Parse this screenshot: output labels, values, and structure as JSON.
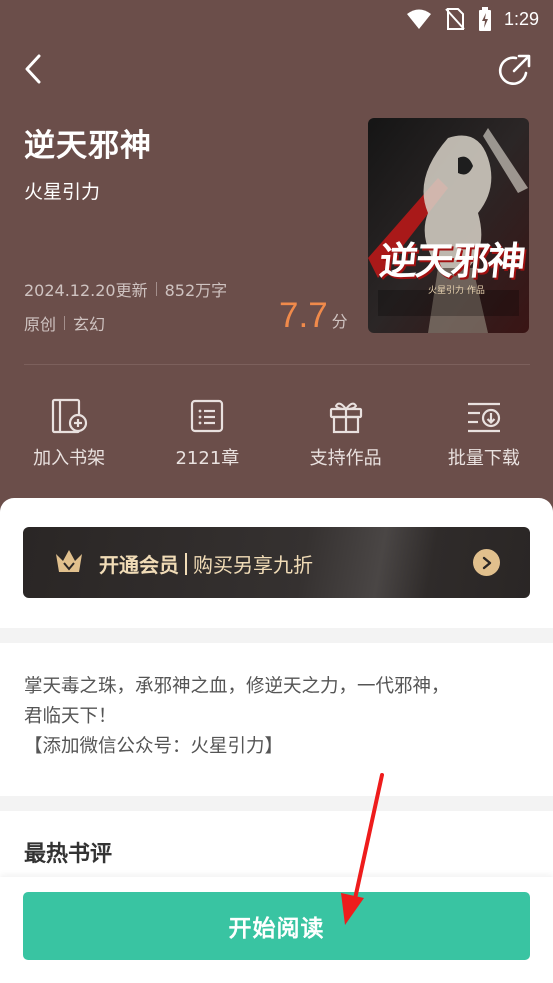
{
  "status_bar": {
    "time": "1:29"
  },
  "book": {
    "title": "逆天邪神",
    "author": "火星引力",
    "update_date": "2024.12.20更新",
    "word_count": "852万字",
    "origin": "原创",
    "genre": "玄幻",
    "rating": "7.7",
    "rating_unit": "分",
    "cover_text": "逆天邪神",
    "cover_author": "火星引力 作品"
  },
  "actions": [
    {
      "label": "加入书架",
      "icon": "add-bookshelf-icon"
    },
    {
      "label": "2121章",
      "icon": "chapter-list-icon"
    },
    {
      "label": "支持作品",
      "icon": "gift-icon"
    },
    {
      "label": "批量下载",
      "icon": "download-icon"
    }
  ],
  "vip": {
    "strong": "开通会员",
    "text": "购买另享九折"
  },
  "intro": {
    "line1": "掌天毒之珠，承邪神之血，修逆天之力，一代邪神，",
    "line2": "君临天下！",
    "line3": "【添加微信公众号：火星引力】"
  },
  "reviews": {
    "title": "最热书评"
  },
  "cta": {
    "label": "开始阅读"
  },
  "colors": {
    "header_bg": "#6b4e4a",
    "accent": "#39c4a2",
    "rating": "#f08a4b",
    "vip_gold": "#f1dcb7"
  }
}
